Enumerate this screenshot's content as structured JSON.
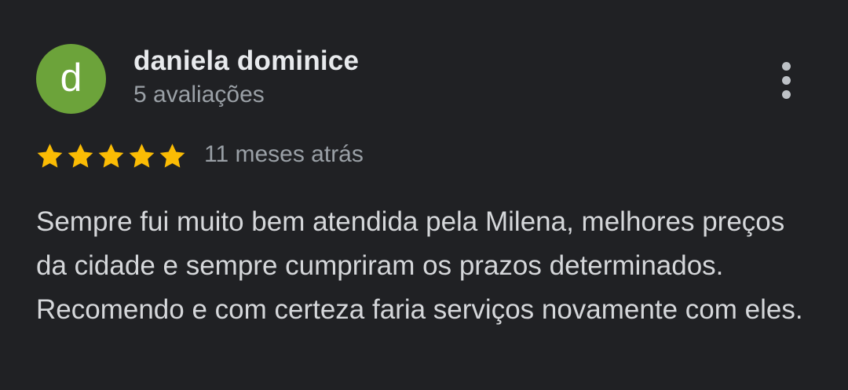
{
  "reviewer": {
    "initial": "d",
    "name": "daniela dominice",
    "reviews_count": "5 avaliações",
    "avatar_color": "#6ca33a"
  },
  "review": {
    "rating": 5,
    "rating_max": 5,
    "star_color": "#fbbc04",
    "time": "11 meses atrás",
    "text": "Sempre fui muito bem atendida pela Milena, melhores preços da cidade e sempre cumpriram os prazos determinados. Recomendo e com certeza faria serviços novamente com eles."
  },
  "icons": {
    "menu": "more-vert-icon",
    "star": "star-icon"
  }
}
